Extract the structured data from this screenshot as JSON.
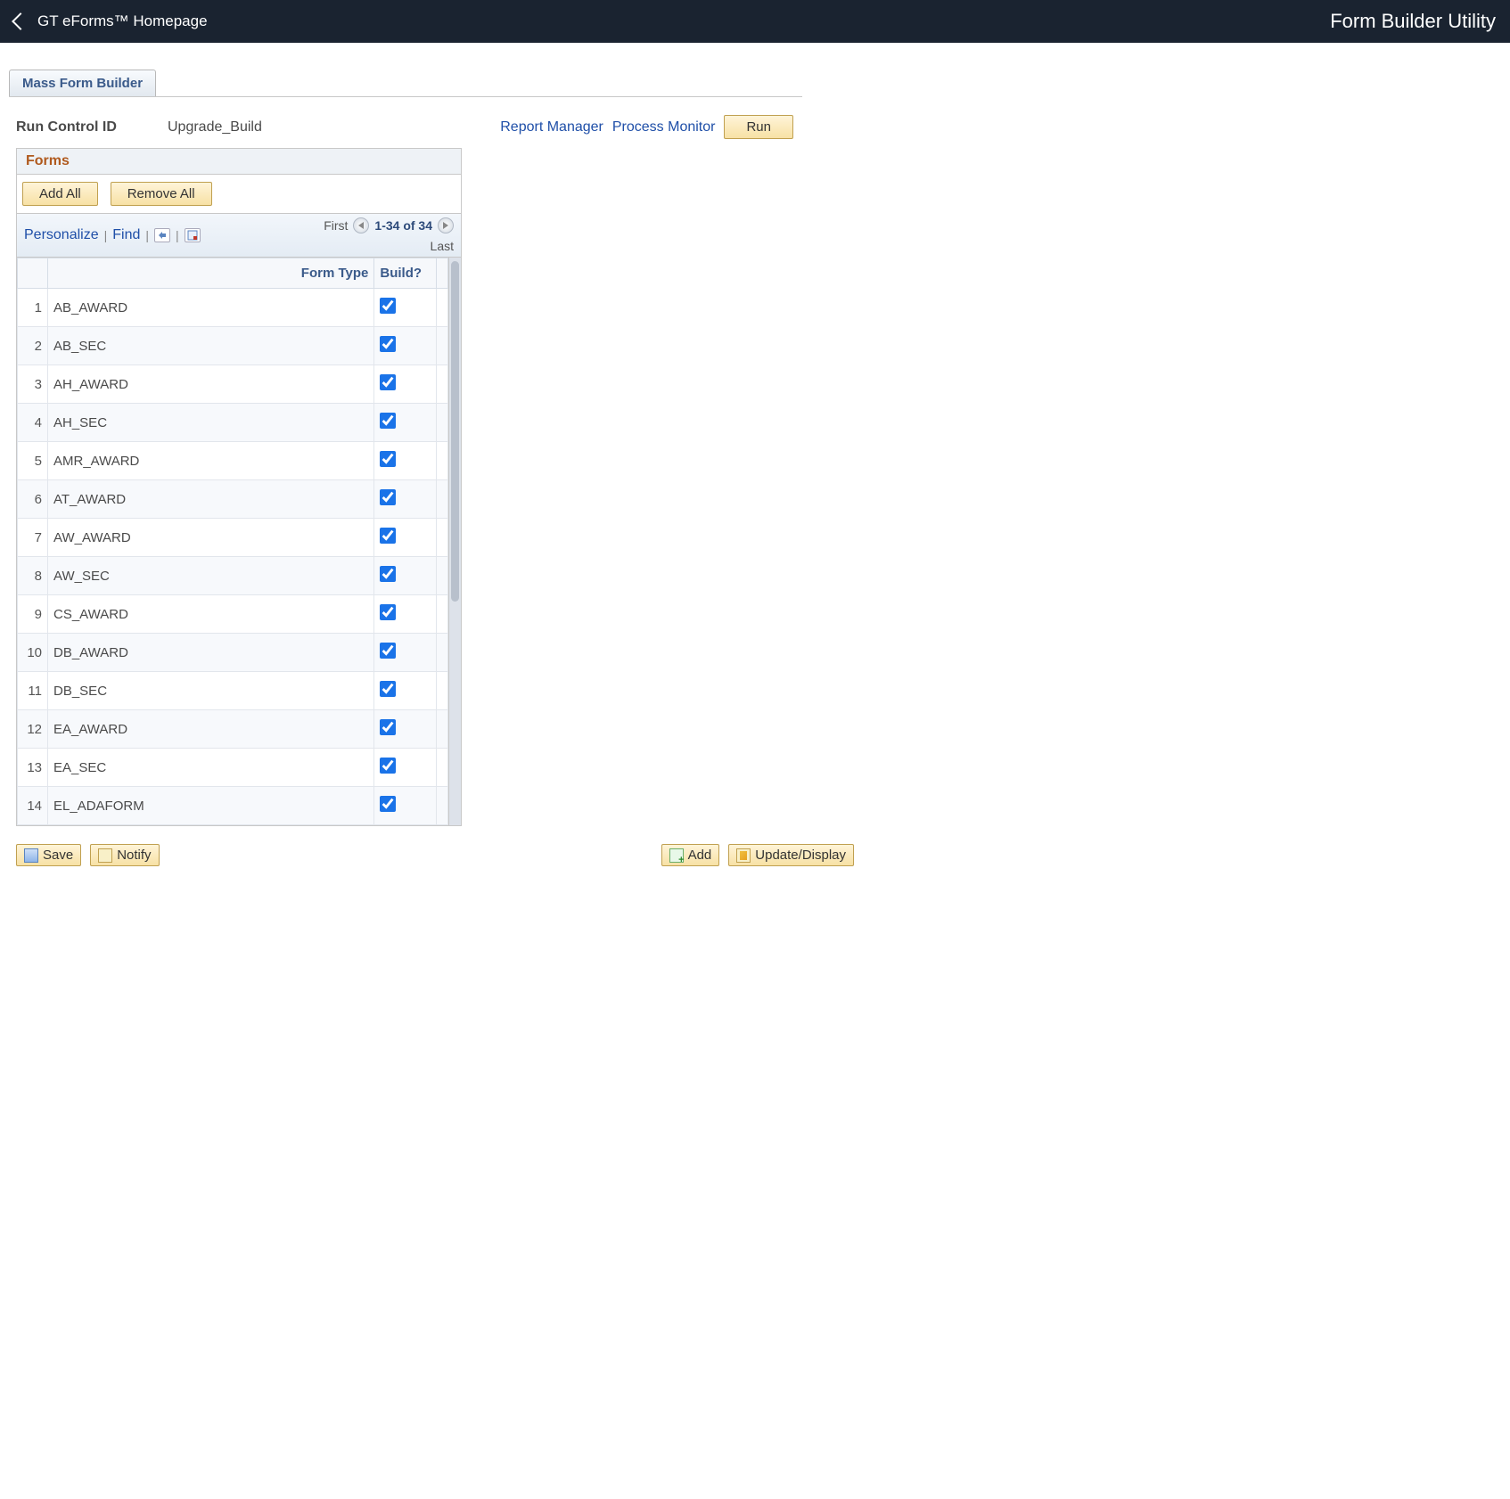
{
  "topbar": {
    "back_label": "GT eForms™ Homepage",
    "title": "Form Builder Utility"
  },
  "tab": {
    "label": "Mass Form Builder"
  },
  "runcontrol": {
    "label": "Run Control ID",
    "value": "Upgrade_Build",
    "report_manager": "Report Manager",
    "process_monitor": "Process Monitor",
    "run_label": "Run"
  },
  "forms": {
    "title": "Forms",
    "add_all": "Add All",
    "remove_all": "Remove All",
    "toolbar": {
      "personalize": "Personalize",
      "find": "Find",
      "first": "First",
      "range": "1-34 of 34",
      "last": "Last"
    },
    "columns": {
      "form_type": "Form Type",
      "build": "Build?"
    },
    "rows": [
      {
        "n": "1",
        "form_type": "AB_AWARD",
        "build": true
      },
      {
        "n": "2",
        "form_type": "AB_SEC",
        "build": true
      },
      {
        "n": "3",
        "form_type": "AH_AWARD",
        "build": true
      },
      {
        "n": "4",
        "form_type": "AH_SEC",
        "build": true
      },
      {
        "n": "5",
        "form_type": "AMR_AWARD",
        "build": true
      },
      {
        "n": "6",
        "form_type": "AT_AWARD",
        "build": true
      },
      {
        "n": "7",
        "form_type": "AW_AWARD",
        "build": true
      },
      {
        "n": "8",
        "form_type": "AW_SEC",
        "build": true
      },
      {
        "n": "9",
        "form_type": "CS_AWARD",
        "build": true
      },
      {
        "n": "10",
        "form_type": "DB_AWARD",
        "build": true
      },
      {
        "n": "11",
        "form_type": "DB_SEC",
        "build": true
      },
      {
        "n": "12",
        "form_type": "EA_AWARD",
        "build": true
      },
      {
        "n": "13",
        "form_type": "EA_SEC",
        "build": true
      },
      {
        "n": "14",
        "form_type": "EL_ADAFORM",
        "build": true
      }
    ]
  },
  "bottom": {
    "save": "Save",
    "notify": "Notify",
    "add": "Add",
    "update": "Update/Display"
  }
}
